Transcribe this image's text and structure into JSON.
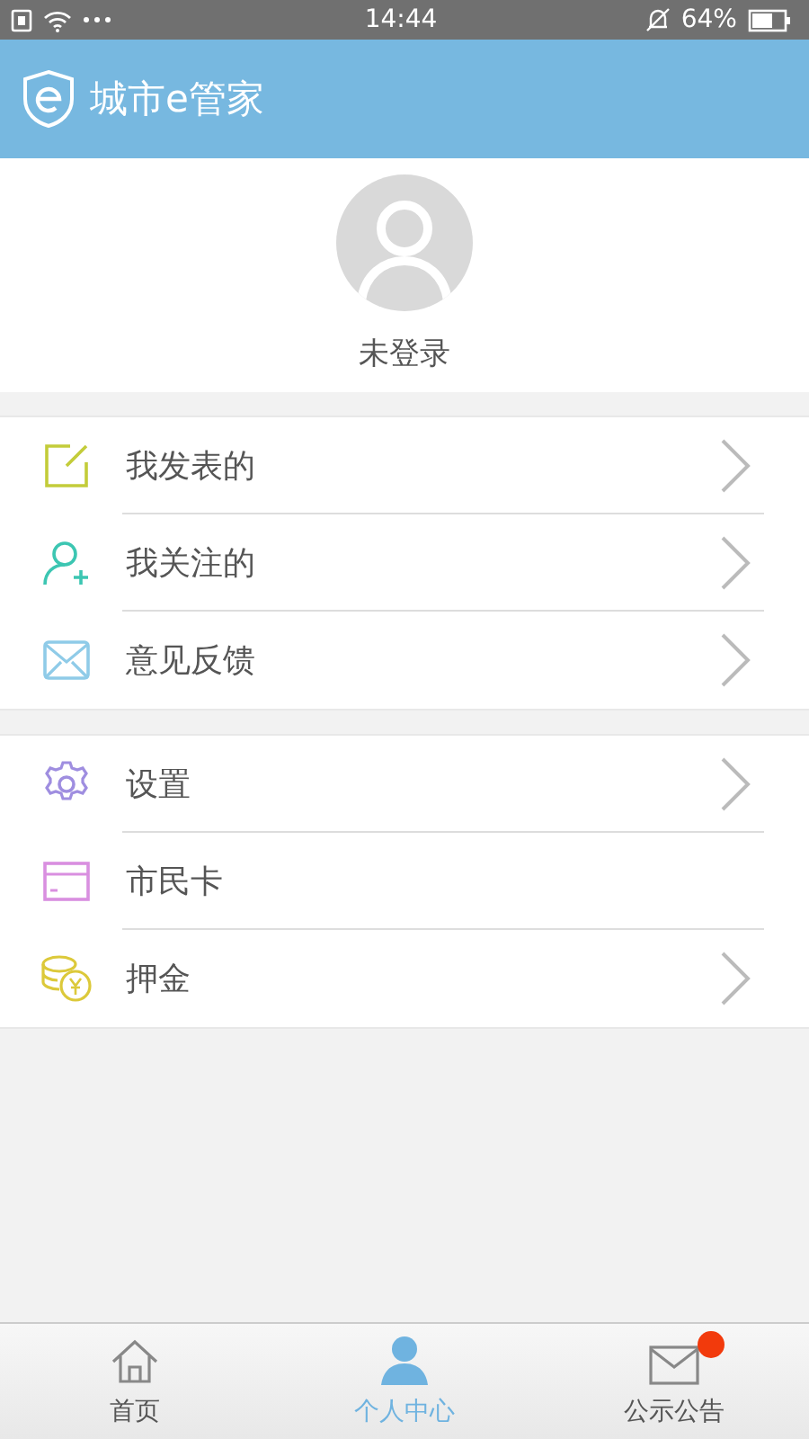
{
  "status_bar": {
    "time": "14:44",
    "battery": "64%"
  },
  "header": {
    "title": "城市e管家"
  },
  "profile": {
    "name": "未登录"
  },
  "menu_groups": [
    [
      {
        "kind": "edit",
        "label": "我发表的",
        "chevron": true
      },
      {
        "kind": "follow",
        "label": "我关注的",
        "chevron": true
      },
      {
        "kind": "feedback",
        "label": "意见反馈",
        "chevron": true
      }
    ],
    [
      {
        "kind": "settings",
        "label": "设置",
        "chevron": true
      },
      {
        "kind": "card",
        "label": "市民卡",
        "chevron": false
      },
      {
        "kind": "deposit",
        "label": "押金",
        "chevron": true
      }
    ]
  ],
  "tab_bar": [
    {
      "kind": "home",
      "label": "首页",
      "selected": false,
      "badge": false
    },
    {
      "kind": "profile",
      "label": "个人中心",
      "selected": true,
      "badge": false
    },
    {
      "kind": "notice",
      "label": "公示公告",
      "selected": false,
      "badge": true
    }
  ]
}
